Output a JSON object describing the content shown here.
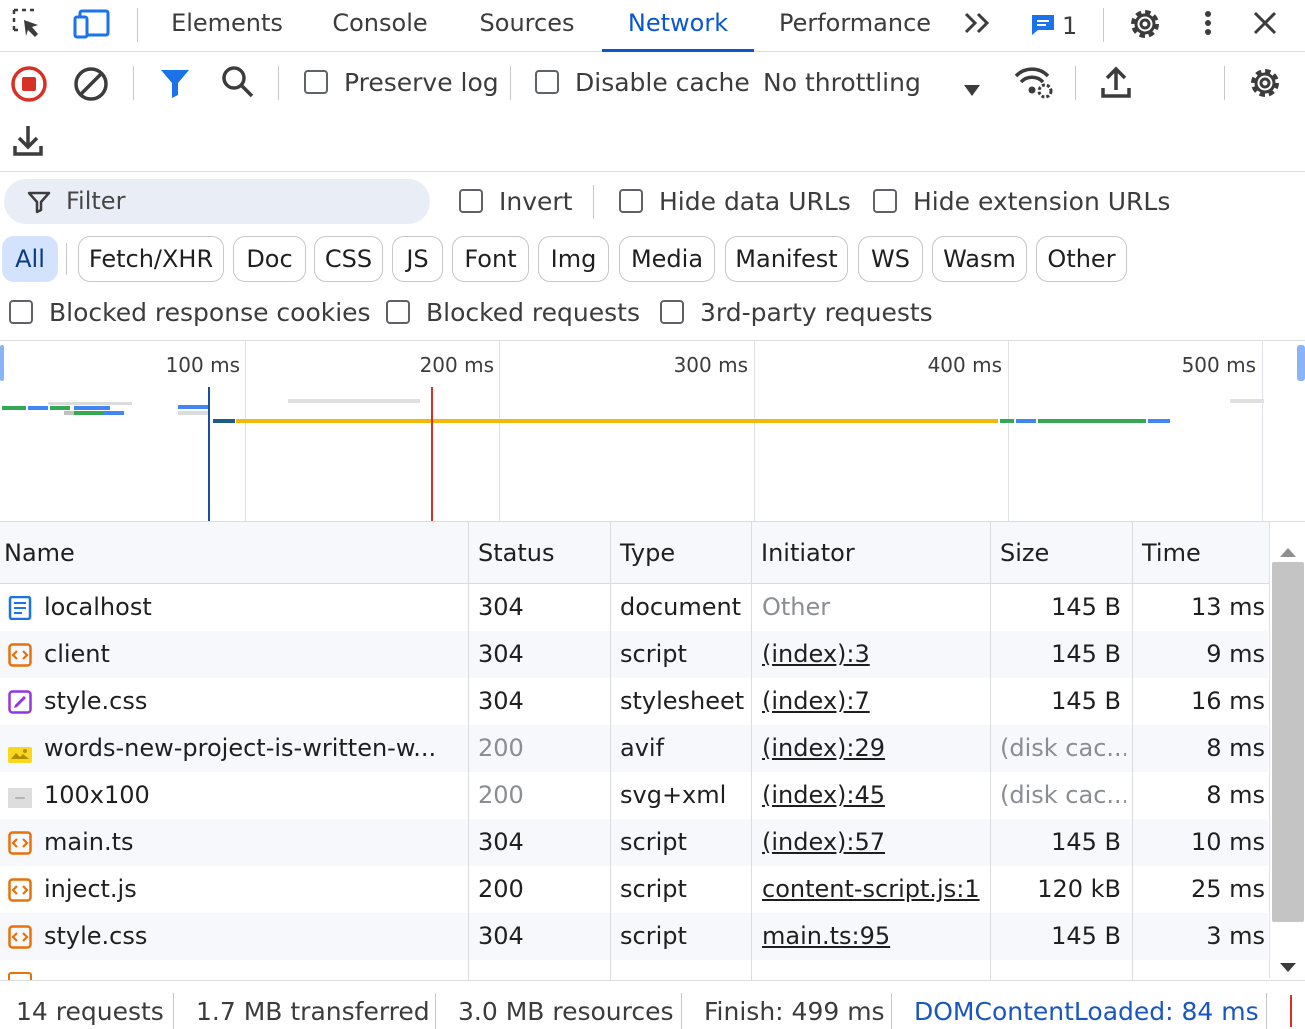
{
  "tabs": {
    "elements": "Elements",
    "console": "Console",
    "sources": "Sources",
    "network": "Network",
    "performance": "Performance",
    "issues_count": "1"
  },
  "toolbar": {
    "preserve_log": "Preserve log",
    "disable_cache": "Disable cache",
    "throttling": "No throttling"
  },
  "filter": {
    "placeholder": "Filter",
    "invert": "Invert",
    "hide_data_urls": "Hide data URLs",
    "hide_extension_urls": "Hide extension URLs"
  },
  "type_chips": [
    "All",
    "Fetch/XHR",
    "Doc",
    "CSS",
    "JS",
    "Font",
    "Img",
    "Media",
    "Manifest",
    "WS",
    "Wasm",
    "Other"
  ],
  "extra_filters": {
    "blocked_cookies": "Blocked response cookies",
    "blocked_requests": "Blocked requests",
    "third_party": "3rd-party requests"
  },
  "overview": {
    "ticks": [
      "100 ms",
      "200 ms",
      "300 ms",
      "400 ms",
      "500 ms"
    ],
    "colors": {
      "dcl": "#1a4fa0",
      "load": "#d93025",
      "waiting": "#f2b90c",
      "download": "#34a853",
      "queue": "#4285f4"
    }
  },
  "table": {
    "headers": {
      "name": "Name",
      "status": "Status",
      "type": "Type",
      "initiator": "Initiator",
      "size": "Size",
      "time": "Time"
    },
    "rows": [
      {
        "icon": "document-icon",
        "name": "localhost",
        "status": "304",
        "type": "document",
        "initiator": "Other",
        "size": "145 B",
        "time": "13 ms"
      },
      {
        "icon": "script-icon",
        "name": "client",
        "status": "304",
        "type": "script",
        "initiator": "(index):3",
        "size": "145 B",
        "time": "9 ms"
      },
      {
        "icon": "stylesheet-icon",
        "name": "style.css",
        "status": "304",
        "type": "stylesheet",
        "initiator": "(index):7",
        "size": "145 B",
        "time": "16 ms"
      },
      {
        "icon": "image-icon",
        "name": "words-new-project-is-written-w...",
        "status": "200",
        "type": "avif",
        "initiator": "(index):29",
        "size": "(disk cac...",
        "time": "8 ms"
      },
      {
        "icon": "image-placeholder-icon",
        "name": "100x100",
        "status": "200",
        "type": "svg+xml",
        "initiator": "(index):45",
        "size": "(disk cac...",
        "time": "8 ms"
      },
      {
        "icon": "script-icon",
        "name": "main.ts",
        "status": "304",
        "type": "script",
        "initiator": "(index):57",
        "size": "145 B",
        "time": "10 ms"
      },
      {
        "icon": "script-icon",
        "name": "inject.js",
        "status": "200",
        "type": "script",
        "initiator": "content-script.js:1",
        "size": "120 kB",
        "time": "25 ms"
      },
      {
        "icon": "script-icon",
        "name": "style.css",
        "status": "304",
        "type": "script",
        "initiator": "main.ts:95",
        "size": "145 B",
        "time": "3 ms"
      }
    ]
  },
  "status_bar": {
    "requests": "14 requests",
    "transferred": "1.7 MB transferred",
    "resources": "3.0 MB resources",
    "finish": "Finish: 499 ms",
    "dcl": "DOMContentLoaded: 84 ms"
  }
}
